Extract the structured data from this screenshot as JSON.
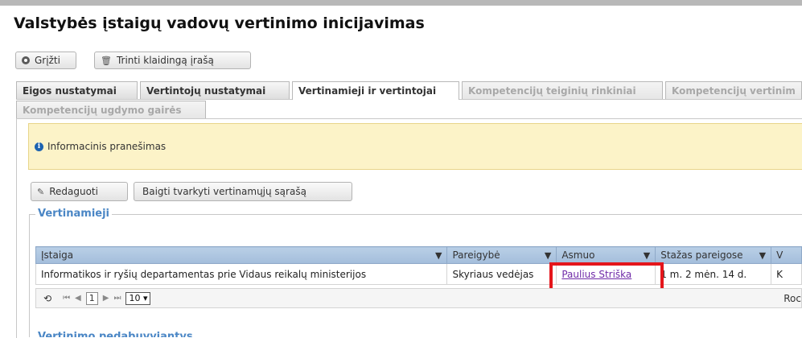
{
  "page": {
    "title": "Valstybės įstaigų vadovų vertinimo inicijavimas"
  },
  "toolbar": {
    "back_label": "Grįžti",
    "delete_label": "Trinti klaidingą įrašą"
  },
  "tabs": [
    {
      "label": "Eigos nustatymai",
      "state": "normal"
    },
    {
      "label": "Vertintojų nustatymai",
      "state": "normal"
    },
    {
      "label": "Vertinamieji ir vertintojai",
      "state": "active"
    },
    {
      "label": "Kompetencijų teiginių rinkiniai",
      "state": "disabled"
    },
    {
      "label": "Kompetencijų vertinim",
      "state": "disabled"
    },
    {
      "label": "Kompetencijų ugdymo gairės",
      "state": "disabled"
    }
  ],
  "info": {
    "text": "Informacinis pranešimas",
    "icon": "info-icon"
  },
  "actions": {
    "edit_label": "Redaguoti",
    "finish_label": "Baigti tvarkyti vertinamųjų sąrašą"
  },
  "section": {
    "title": "Vertinamieji",
    "next_title": "Vertinimo pedabuvviantys"
  },
  "grid": {
    "columns": [
      "Įstaiga",
      "Pareigybė",
      "Asmuo",
      "Stažas pareigose",
      "V"
    ],
    "rows": [
      [
        "Informatikos ir ryšių departamentas prie Vidaus reikalų ministerijos",
        "Skyriaus vedėjas",
        "Paulius Striška",
        "1 m. 2 mėn. 14 d.",
        "K"
      ]
    ],
    "pager": {
      "page": "1",
      "page_size": "10 ▾",
      "records": "Roc"
    }
  },
  "colors": {
    "accent": "#4a86c5",
    "highlight": "#e4151b",
    "info_bg": "#fcf3c8",
    "link": "#6f2aa8"
  }
}
